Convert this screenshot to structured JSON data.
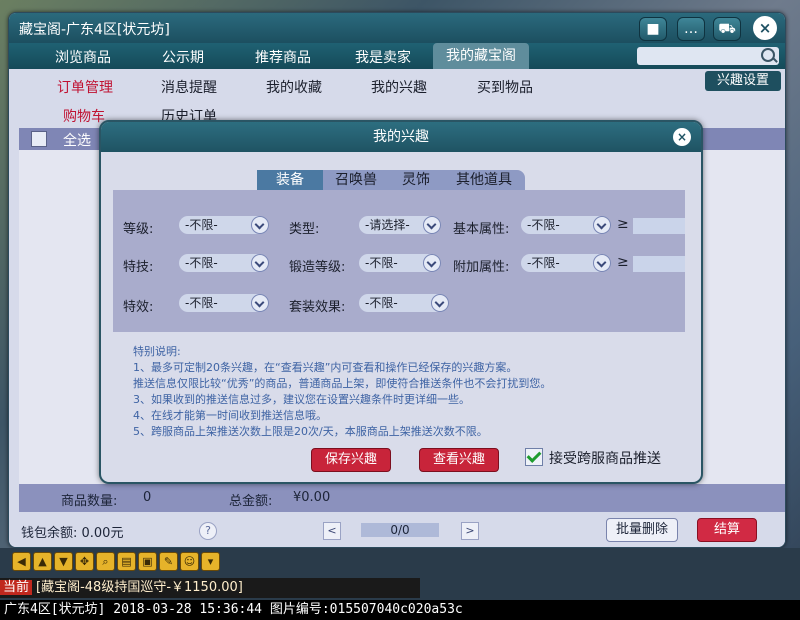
{
  "window": {
    "title": "藏宝阁-广东4区[状元坊]"
  },
  "nav": [
    "浏览商品",
    "公示期",
    "推荐商品",
    "我是卖家",
    "我的藏宝阁"
  ],
  "subnav": [
    "订单管理",
    "消息提醒",
    "我的收藏",
    "我的兴趣",
    "买到物品",
    "购物车",
    "历史订单"
  ],
  "interest_btn": "兴趣设置",
  "list": {
    "select_all": "全选"
  },
  "footer": {
    "count_label": "商品数量:",
    "count_value": "0",
    "total_label": "总金额:",
    "total_value": "¥0.00",
    "wallet": "钱包余额: 0.00元",
    "help": "?",
    "page": "0/0",
    "prev": "<",
    "next": ">",
    "bulk_delete": "批量删除",
    "checkout": "结算"
  },
  "dialog": {
    "title": "我的兴趣",
    "close": "×",
    "tabs": [
      "装备",
      "召唤兽",
      "灵饰",
      "其他道具"
    ],
    "active_tab": "装备",
    "filters": {
      "level_label": "等级:",
      "level_value": "-不限-",
      "type_label": "类型:",
      "type_value": "-请选择-",
      "base_attr_label": "基本属性:",
      "base_attr_value": "-不限-",
      "skill_label": "特技:",
      "skill_value": "-不限-",
      "forge_label": "锻造等级:",
      "forge_value": "-不限-",
      "add_attr_label": "附加属性:",
      "add_attr_value": "-不限-",
      "effect_label": "特效:",
      "effect_value": "-不限-",
      "set_label": "套装效果:",
      "set_value": "-不限-",
      "ge": "≥"
    },
    "notes": [
      "特别说明:",
      "1、最多可定制20条兴趣，在“查看兴趣”内可查看和操作已经保存的兴趣方案。",
      "   推送信息仅限比较“优秀”的商品，普通商品上架，即使符合推送条件也不会打扰到您。",
      "3、如果收到的推送信息过多，建议您在设置兴趣条件时更详细一些。",
      "4、在线才能第一时间收到推送信息哦。",
      "5、跨服商品上架推送次数上限是20次/天，本服商品上架推送次数不限。"
    ],
    "save_btn": "保存兴趣",
    "view_btn": "查看兴趣",
    "accept_label": "接受跨服商品推送",
    "accept_checked": true
  },
  "chat": {
    "tag": "当前",
    "text": "[藏宝阁-48级持国巡守-￥1150.00]"
  },
  "status_bar": "广东4区[状元坊] 2018-03-28 15:36:44 图片编号:015507040c020a53c"
}
